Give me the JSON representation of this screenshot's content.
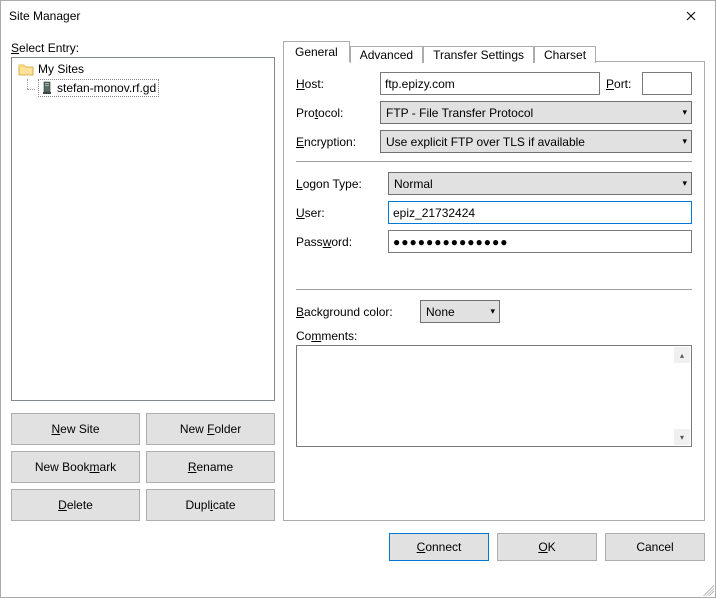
{
  "window": {
    "title": "Site Manager",
    "close_aria": "Close"
  },
  "left": {
    "select_entry_pre": "S",
    "select_entry_post": "elect Entry:",
    "root_label": "My Sites",
    "site_label": "stefan-monov.rf.gd",
    "buttons": {
      "new_site_pre": "N",
      "new_site_post": "ew Site",
      "new_folder_pre": "New ",
      "new_folder_u": "F",
      "new_folder_post": "older",
      "new_bookmark_pre": "New Book",
      "new_bookmark_u": "m",
      "new_bookmark_post": "ark",
      "rename_pre": "R",
      "rename_post": "ename",
      "delete_pre": "D",
      "delete_post": "elete",
      "duplicate_pre": "Dupl",
      "duplicate_u": "i",
      "duplicate_post": "cate"
    }
  },
  "tabs": {
    "general": "General",
    "advanced": "Advanced",
    "transfer": "Transfer Settings",
    "charset": "Charset"
  },
  "general": {
    "host_pre": "H",
    "host_post": "ost:",
    "host_value": "ftp.epizy.com",
    "port_pre": "P",
    "port_post": "ort:",
    "port_value": "",
    "protocol_pre": "Pro",
    "protocol_u": "t",
    "protocol_post": "ocol:",
    "protocol_value": "FTP - File Transfer Protocol",
    "encryption_pre": "E",
    "encryption_post": "ncryption:",
    "encryption_value": "Use explicit FTP over TLS if available",
    "logon_pre": "L",
    "logon_post": "ogon Type:",
    "logon_value": "Normal",
    "user_pre": "U",
    "user_post": "ser:",
    "user_value": "epiz_21732424",
    "password_pre": "Pass",
    "password_u": "w",
    "password_post": "ord:",
    "password_value": "●●●●●●●●●●●●●●",
    "bgcolor_pre": "B",
    "bgcolor_post": "ackground color:",
    "bgcolor_value": "None",
    "comments_pre": "Co",
    "comments_u": "m",
    "comments_post": "ments:"
  },
  "bottom": {
    "connect_pre": "C",
    "connect_post": "onnect",
    "ok_pre": "O",
    "ok_post": "K",
    "cancel": "Cancel"
  }
}
